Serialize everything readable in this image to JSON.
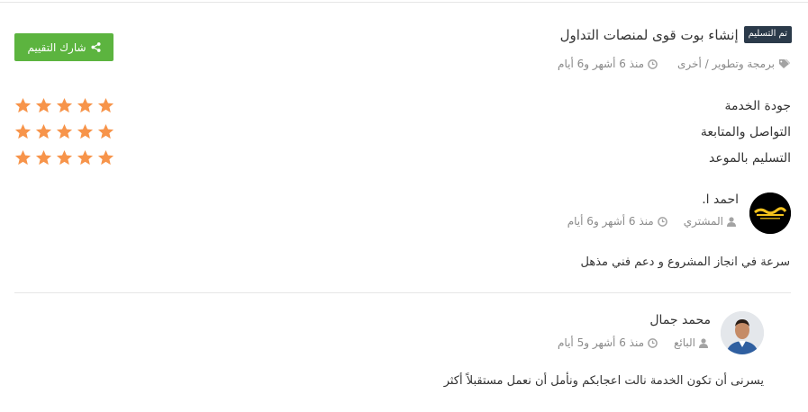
{
  "project": {
    "status_badge": "تم التسليم",
    "title": "إنشاء بوت قوى لمنصات التداول",
    "category": "برمجة وتطوير / أخرى",
    "time": "منذ 6 أشهر و6 أيام"
  },
  "share_button": {
    "label": "شارك التقييم"
  },
  "ratings": [
    {
      "label": "جودة الخدمة",
      "stars": 5,
      "max": 5
    },
    {
      "label": "التواصل والمتابعة",
      "stars": 5,
      "max": 5
    },
    {
      "label": "التسليم بالموعد",
      "stars": 5,
      "max": 5
    }
  ],
  "buyer": {
    "name": "احمد ا.",
    "role": "المشتري",
    "time": "منذ 6 أشهر و6 أيام",
    "comment": "سرعة في انجاز المشروع و دعم فني مذهل"
  },
  "seller": {
    "name": "محمد جمال",
    "role": "البائع",
    "time": "منذ 6 أشهر و5 أيام",
    "comment": "يسرنى أن تكون الخدمة نالت اعجابكم ونأمل أن نعمل مستقبلاً أكثر"
  },
  "colors": {
    "star": "#f7944a",
    "share_button": "#5cb43f",
    "badge": "#2b3a4a"
  },
  "icons": [
    "tag-icon",
    "clock-icon",
    "share-icon",
    "star-icon",
    "user-icon"
  ]
}
